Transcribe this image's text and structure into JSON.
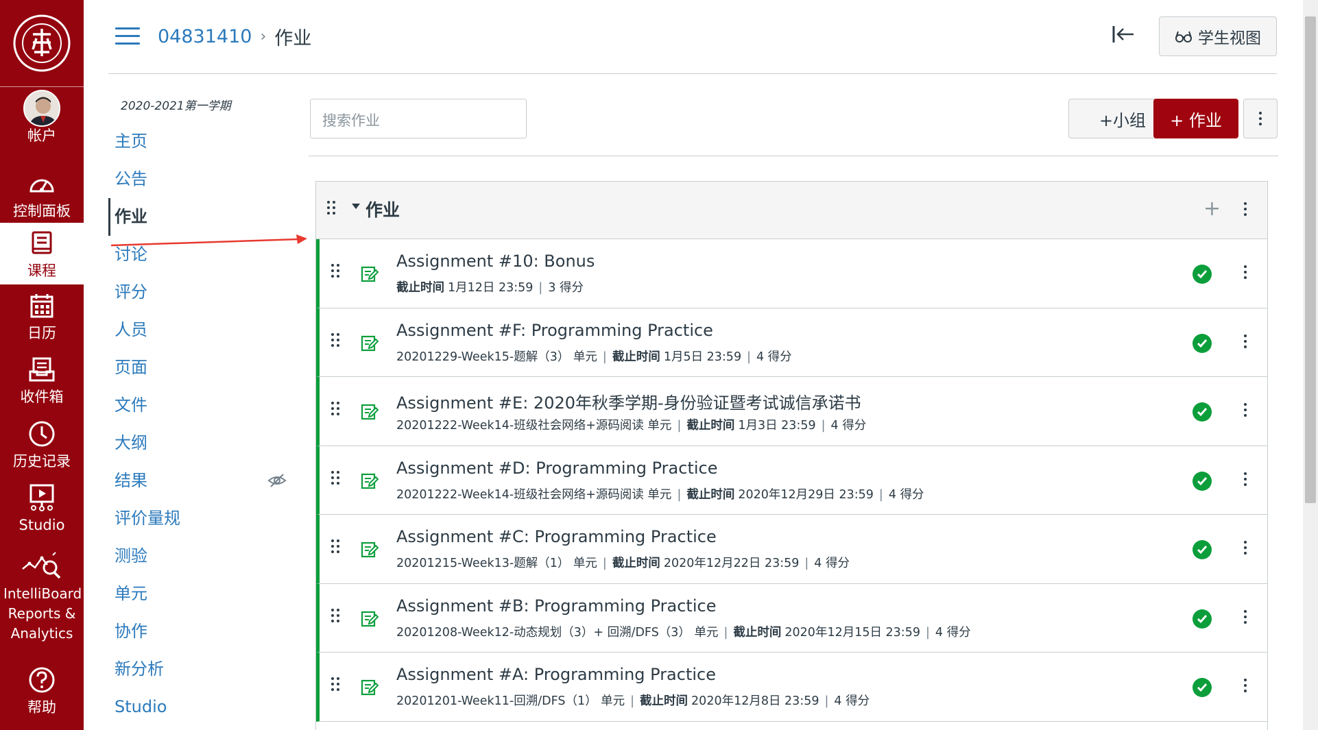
{
  "global_nav": {
    "logo_icon": "university-seal-icon",
    "items": [
      {
        "icon": "account-avatar",
        "label": "帐户"
      },
      {
        "icon": "dashboard-icon",
        "label": "控制面板"
      },
      {
        "icon": "courses-icon",
        "label": "课程"
      },
      {
        "icon": "calendar-icon",
        "label": "日历"
      },
      {
        "icon": "inbox-icon",
        "label": "收件箱"
      },
      {
        "icon": "history-icon",
        "label": "历史记录"
      },
      {
        "icon": "studio-icon",
        "label": "Studio"
      },
      {
        "icon": "intelliboard-icon",
        "label": "IntelliBoard Reports & Analytics"
      },
      {
        "icon": "help-icon",
        "label": "帮助"
      }
    ],
    "active_item": "课程",
    "brand_color": "#94040f"
  },
  "header": {
    "course_code": "04831410",
    "current_page": "作业",
    "student_view_label": "学生视图"
  },
  "course_nav": {
    "term": "2020-2021第一学期",
    "items": [
      {
        "label": "主页"
      },
      {
        "label": "公告"
      },
      {
        "label": "作业",
        "active": true
      },
      {
        "label": "讨论"
      },
      {
        "label": "评分"
      },
      {
        "label": "人员"
      },
      {
        "label": "页面"
      },
      {
        "label": "文件"
      },
      {
        "label": "大纲"
      },
      {
        "label": "结果",
        "hidden_icon": "eye-slash-icon"
      },
      {
        "label": "评价量规"
      },
      {
        "label": "测验"
      },
      {
        "label": "单元"
      },
      {
        "label": "协作"
      },
      {
        "label": "新分析"
      },
      {
        "label": "Studio"
      }
    ]
  },
  "toolbar": {
    "search_placeholder": "搜索作业",
    "group_button": "+小组",
    "assignment_button": "+ 作业"
  },
  "assignment_group": {
    "title": "作业",
    "assignments": [
      {
        "title": "Assignment #10: Bonus",
        "module": "",
        "due_label": "截止时间",
        "due": "1月12日 23:59",
        "points": "3 得分",
        "published": true
      },
      {
        "title": "Assignment #F: Programming Practice",
        "module": "20201229-Week15-题解（3） 单元",
        "due_label": "截止时间",
        "due": "1月5日 23:59",
        "points": "4 得分",
        "published": true
      },
      {
        "title": "Assignment #E: 2020年秋季学期-身份验证暨考试诚信承诺书",
        "module": "20201222-Week14-班级社会网络+源码阅读 单元",
        "due_label": "截止时间",
        "due": "1月3日 23:59",
        "points": "4 得分",
        "published": true
      },
      {
        "title": "Assignment #D: Programming Practice",
        "module": "20201222-Week14-班级社会网络+源码阅读 单元",
        "due_label": "截止时间",
        "due": "2020年12月29日 23:59",
        "points": "4 得分",
        "published": true
      },
      {
        "title": "Assignment #C: Programming Practice",
        "module": "20201215-Week13-题解（1） 单元",
        "due_label": "截止时间",
        "due": "2020年12月22日 23:59",
        "points": "4 得分",
        "published": true
      },
      {
        "title": "Assignment #B: Programming Practice",
        "module": "20201208-Week12-动态规划（3）+ 回溯/DFS（3） 单元",
        "due_label": "截止时间",
        "due": "2020年12月15日 23:59",
        "points": "4 得分",
        "published": true
      },
      {
        "title": "Assignment #A: Programming Practice",
        "module": "20201201-Week11-回溯/DFS（1） 单元",
        "due_label": "截止时间",
        "due": "2020年12月8日 23:59",
        "points": "4 得分",
        "published": true
      }
    ]
  },
  "colors": {
    "link": "#2b7abc",
    "published_green": "#0b9e3b",
    "primary_button": "#a0050f",
    "annotation_arrow": "#e8392f"
  }
}
